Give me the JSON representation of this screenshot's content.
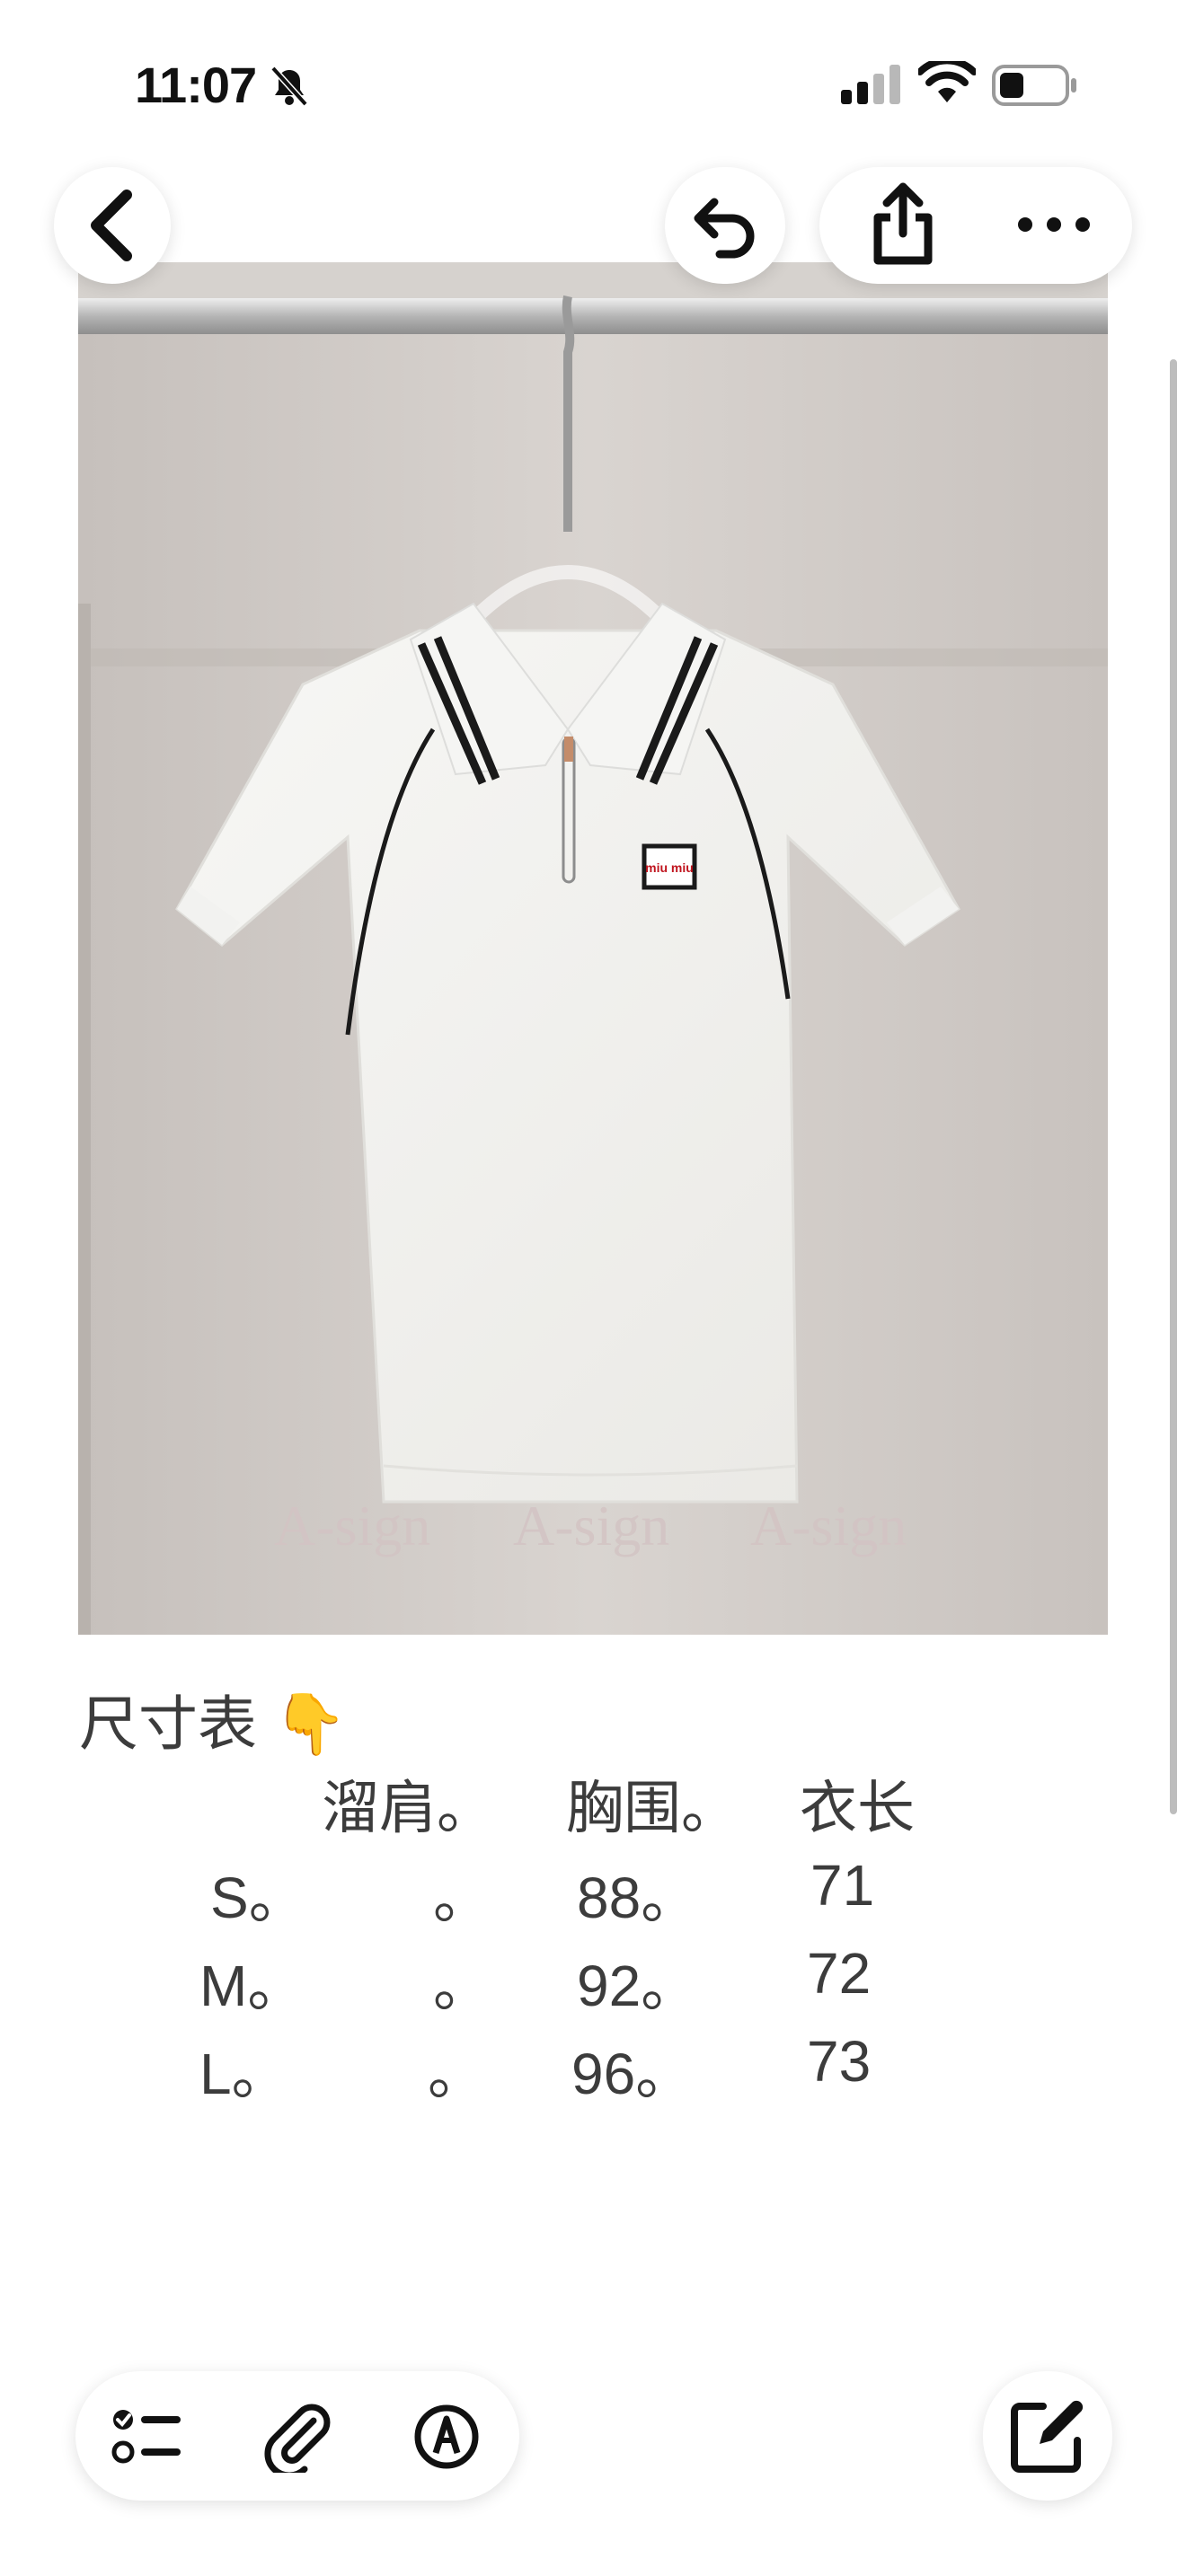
{
  "status_bar": {
    "time": "11:07",
    "icons": [
      "bell-slash-icon",
      "cellular-signal-icon",
      "wifi-icon",
      "battery-icon"
    ]
  },
  "nav": {
    "back_icon": "chevron-left-icon",
    "undo_icon": "undo-icon",
    "share_icon": "share-icon",
    "more_icon": "ellipsis-icon"
  },
  "photo": {
    "logo_text": "miu miu",
    "watermarks": [
      "A-sign",
      "A-sign",
      "A-sign"
    ]
  },
  "note": {
    "title": "尺寸表 👇",
    "table": {
      "headers": [
        "溜肩。",
        "胸围。",
        "衣长"
      ],
      "rows": [
        {
          "size": "S。",
          "shoulder": "。",
          "chest": "88。",
          "length": "71"
        },
        {
          "size": "M。",
          "shoulder": "。",
          "chest": "92。",
          "length": "72"
        },
        {
          "size": "L。",
          "shoulder": "。",
          "chest": "96。",
          "length": "73"
        }
      ]
    }
  },
  "toolbar": {
    "icons": [
      "checklist-icon",
      "paperclip-icon",
      "markup-pen-icon",
      "compose-icon"
    ]
  },
  "colors": {
    "background": "#ffffff",
    "text": "#3c3c3c",
    "logo_red": "#c0141e"
  }
}
